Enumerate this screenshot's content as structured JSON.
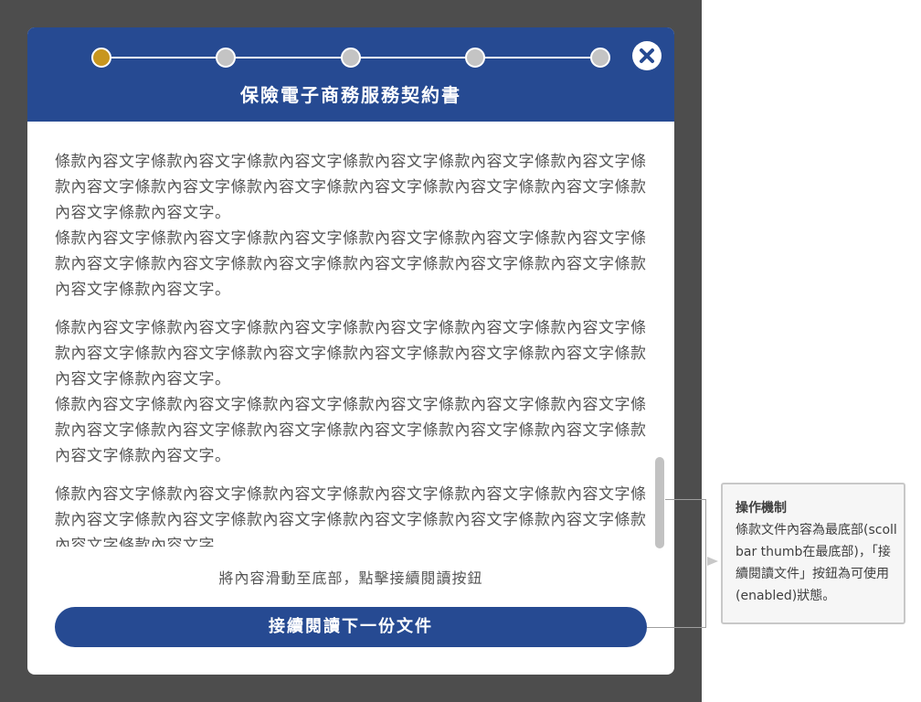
{
  "modal": {
    "title": "保險電子商務服務契約書",
    "steps": [
      {
        "state": "active"
      },
      {
        "state": "inactive"
      },
      {
        "state": "inactive"
      },
      {
        "state": "inactive"
      },
      {
        "state": "inactive"
      }
    ],
    "content_groups": [
      {
        "paragraphs": [
          "條款內容文字條款內容文字條款內容文字條款內容文字條款內容文字條款內容文字條款內容文字條款內容文字條款內容文字條款內容文字條款內容文字條款內容文字條款內容文字條款內容文字。",
          "條款內容文字條款內容文字條款內容文字條款內容文字條款內容文字條款內容文字條款內容文字條款內容文字條款內容文字條款內容文字條款內容文字條款內容文字條款內容文字條款內容文字。"
        ]
      },
      {
        "paragraphs": [
          "條款內容文字條款內容文字條款內容文字條款內容文字條款內容文字條款內容文字條款內容文字條款內容文字條款內容文字條款內容文字條款內容文字條款內容文字條款內容文字條款內容文字。",
          "條款內容文字條款內容文字條款內容文字條款內容文字條款內容文字條款內容文字條款內容文字條款內容文字條款內容文字條款內容文字條款內容文字條款內容文字條款內容文字條款內容文字。"
        ]
      },
      {
        "paragraphs": [
          "條款內容文字條款內容文字條款內容文字條款內容文字條款內容文字條款內容文字條款內容文字條款內容文字條款內容文字條款內容文字條款內容文字條款內容文字條款內容文字條款內容文字。"
        ]
      }
    ],
    "hint": "將內容滑動至底部，點擊接續閱讀按鈕",
    "primary_button_label": "接續閱讀下一份文件"
  },
  "annotation": {
    "title": "操作機制",
    "body": "條款文件內容為最底部(scoll bar thumb在最底部)，「接續閱讀文件」按鈕為可使用(enabled)狀態。"
  },
  "colors": {
    "header_blue": "#264a92",
    "step_active": "#c8961f",
    "step_inactive": "#c4c4c4",
    "backdrop": "#4d4d4d"
  },
  "icons": {
    "close": "close-icon"
  }
}
